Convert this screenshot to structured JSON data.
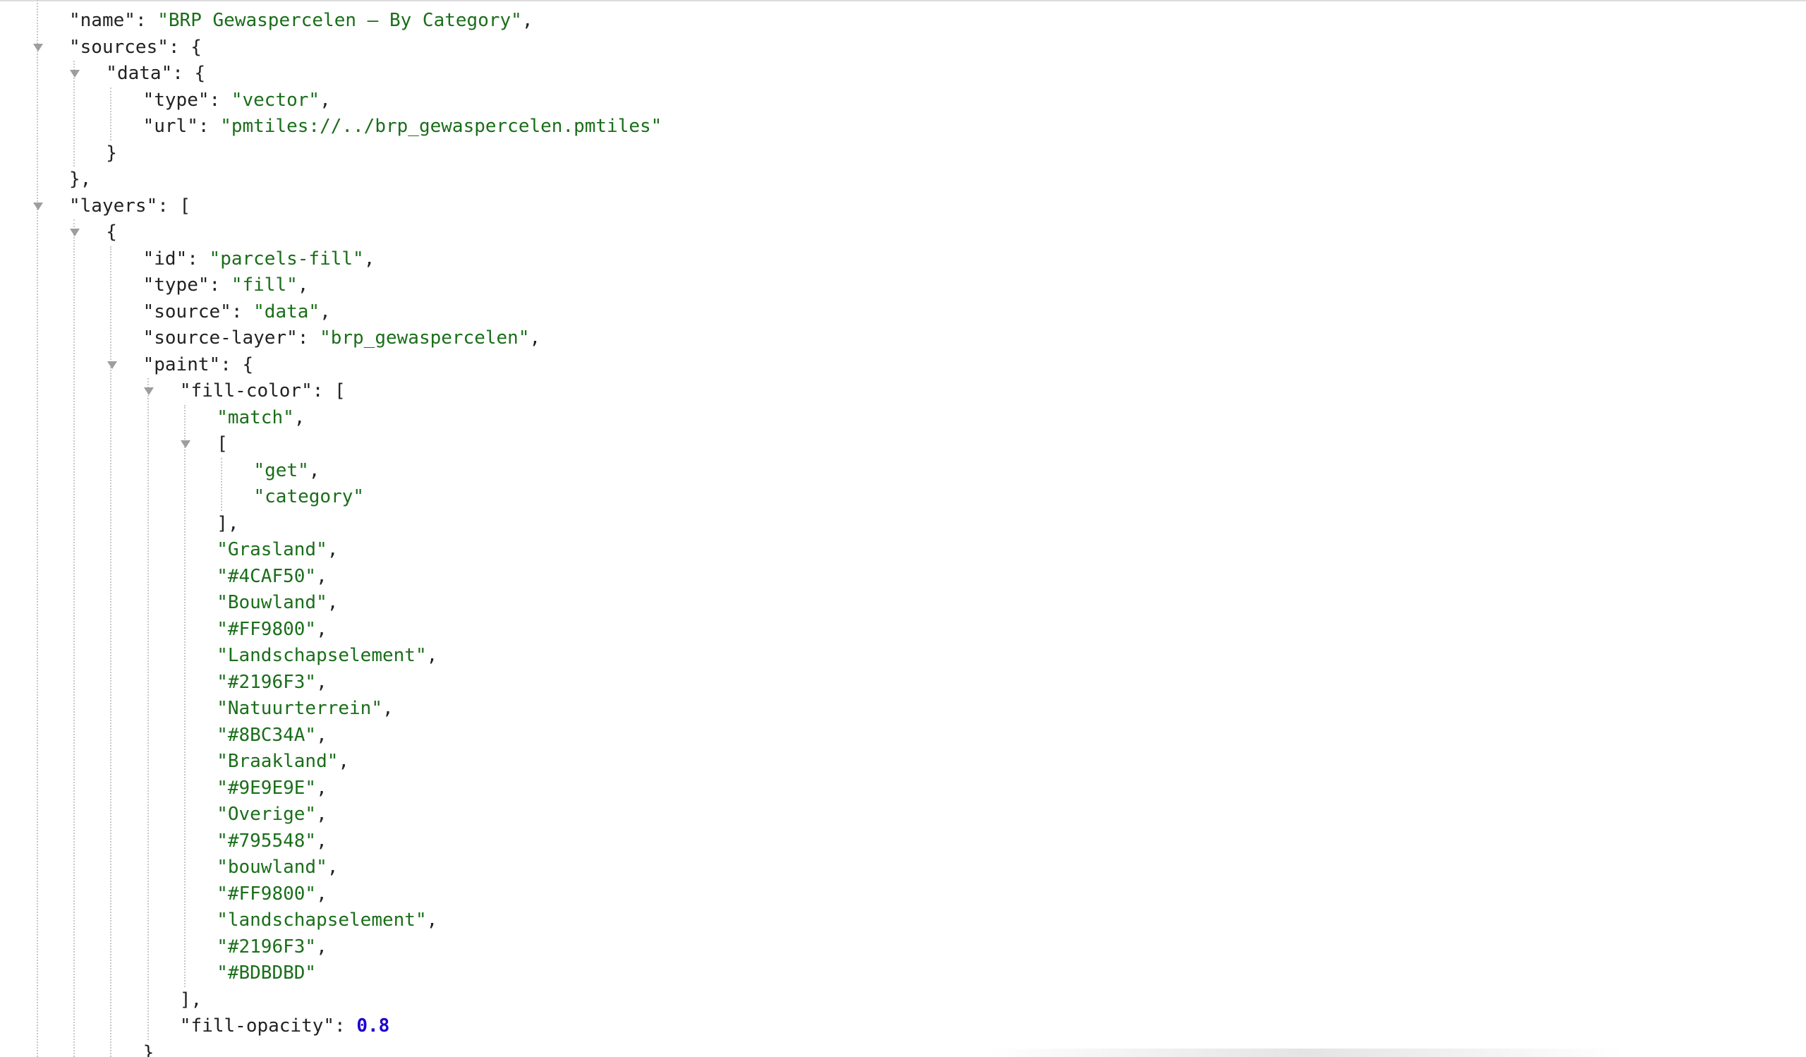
{
  "lines": [
    {
      "depth": 0,
      "toggle": false,
      "key": "name",
      "value": "BRP Gewaspercelen — By Category",
      "vtype": "string",
      "comma": true
    },
    {
      "depth": 0,
      "toggle": true,
      "key": "sources",
      "open": "{"
    },
    {
      "depth": 1,
      "toggle": true,
      "key": "data",
      "open": "{"
    },
    {
      "depth": 2,
      "toggle": false,
      "key": "type",
      "value": "vector",
      "vtype": "string",
      "comma": true
    },
    {
      "depth": 2,
      "toggle": false,
      "key": "url",
      "value": "pmtiles://../brp_gewaspercelen.pmtiles",
      "vtype": "string",
      "comma": false
    },
    {
      "depth": 1,
      "toggle": false,
      "close": "}",
      "comma": false
    },
    {
      "depth": 0,
      "toggle": false,
      "close": "}",
      "comma": true
    },
    {
      "depth": 0,
      "toggle": true,
      "key": "layers",
      "open": "["
    },
    {
      "depth": 1,
      "toggle": true,
      "open": "{"
    },
    {
      "depth": 2,
      "toggle": false,
      "key": "id",
      "value": "parcels-fill",
      "vtype": "string",
      "comma": true
    },
    {
      "depth": 2,
      "toggle": false,
      "key": "type",
      "value": "fill",
      "vtype": "string",
      "comma": true
    },
    {
      "depth": 2,
      "toggle": false,
      "key": "source",
      "value": "data",
      "vtype": "string",
      "comma": true
    },
    {
      "depth": 2,
      "toggle": false,
      "key": "source-layer",
      "value": "brp_gewaspercelen",
      "vtype": "string",
      "comma": true
    },
    {
      "depth": 2,
      "toggle": true,
      "key": "paint",
      "open": "{"
    },
    {
      "depth": 3,
      "toggle": true,
      "key": "fill-color",
      "open": "["
    },
    {
      "depth": 4,
      "toggle": false,
      "value": "match",
      "vtype": "string",
      "comma": true
    },
    {
      "depth": 4,
      "toggle": true,
      "open": "["
    },
    {
      "depth": 5,
      "toggle": false,
      "value": "get",
      "vtype": "string",
      "comma": true
    },
    {
      "depth": 5,
      "toggle": false,
      "value": "category",
      "vtype": "string",
      "comma": false
    },
    {
      "depth": 4,
      "toggle": false,
      "close": "]",
      "comma": true
    },
    {
      "depth": 4,
      "toggle": false,
      "value": "Grasland",
      "vtype": "string",
      "comma": true
    },
    {
      "depth": 4,
      "toggle": false,
      "value": "#4CAF50",
      "vtype": "string",
      "comma": true
    },
    {
      "depth": 4,
      "toggle": false,
      "value": "Bouwland",
      "vtype": "string",
      "comma": true
    },
    {
      "depth": 4,
      "toggle": false,
      "value": "#FF9800",
      "vtype": "string",
      "comma": true
    },
    {
      "depth": 4,
      "toggle": false,
      "value": "Landschapselement",
      "vtype": "string",
      "comma": true
    },
    {
      "depth": 4,
      "toggle": false,
      "value": "#2196F3",
      "vtype": "string",
      "comma": true
    },
    {
      "depth": 4,
      "toggle": false,
      "value": "Natuurterrein",
      "vtype": "string",
      "comma": true
    },
    {
      "depth": 4,
      "toggle": false,
      "value": "#8BC34A",
      "vtype": "string",
      "comma": true
    },
    {
      "depth": 4,
      "toggle": false,
      "value": "Braakland",
      "vtype": "string",
      "comma": true
    },
    {
      "depth": 4,
      "toggle": false,
      "value": "#9E9E9E",
      "vtype": "string",
      "comma": true
    },
    {
      "depth": 4,
      "toggle": false,
      "value": "Overige",
      "vtype": "string",
      "comma": true
    },
    {
      "depth": 4,
      "toggle": false,
      "value": "#795548",
      "vtype": "string",
      "comma": true
    },
    {
      "depth": 4,
      "toggle": false,
      "value": "bouwland",
      "vtype": "string",
      "comma": true
    },
    {
      "depth": 4,
      "toggle": false,
      "value": "#FF9800",
      "vtype": "string",
      "comma": true
    },
    {
      "depth": 4,
      "toggle": false,
      "value": "landschapselement",
      "vtype": "string",
      "comma": true
    },
    {
      "depth": 4,
      "toggle": false,
      "value": "#2196F3",
      "vtype": "string",
      "comma": true
    },
    {
      "depth": 4,
      "toggle": false,
      "value": "#BDBDBD",
      "vtype": "string",
      "comma": false
    },
    {
      "depth": 3,
      "toggle": false,
      "close": "]",
      "comma": true
    },
    {
      "depth": 3,
      "toggle": false,
      "key": "fill-opacity",
      "value": "0.8",
      "vtype": "number",
      "comma": false
    },
    {
      "depth": 2,
      "toggle": false,
      "close": "}",
      "comma": false
    }
  ],
  "colors": {
    "key": "#222222",
    "string": "#1a6e1a",
    "number": "#1c00cf",
    "toggle": "#9e9e9e",
    "guide": "#c8c8c8"
  }
}
